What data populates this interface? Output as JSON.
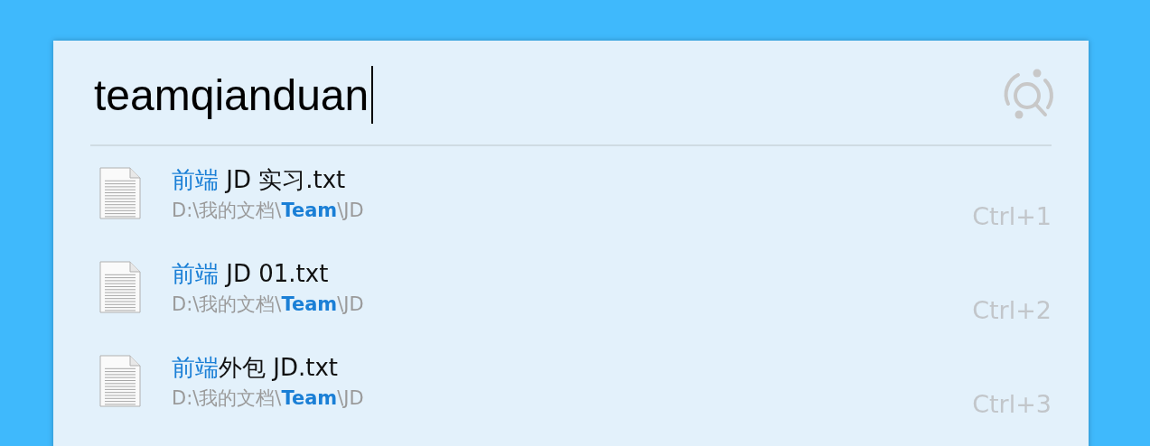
{
  "search": {
    "value": "teamqianduan"
  },
  "results": [
    {
      "title": [
        {
          "text": "前端",
          "match": true
        },
        {
          "text": " JD 实习.txt",
          "match": false
        }
      ],
      "path": [
        {
          "text": "D:\\我的文档\\",
          "match": false
        },
        {
          "text": "Team",
          "match": true
        },
        {
          "text": "\\JD",
          "match": false
        }
      ],
      "shortcut": "Ctrl+1"
    },
    {
      "title": [
        {
          "text": "前端",
          "match": true
        },
        {
          "text": " JD 01.txt",
          "match": false
        }
      ],
      "path": [
        {
          "text": "D:\\我的文档\\",
          "match": false
        },
        {
          "text": "Team",
          "match": true
        },
        {
          "text": "\\JD",
          "match": false
        }
      ],
      "shortcut": "Ctrl+2"
    },
    {
      "title": [
        {
          "text": "前端",
          "match": true
        },
        {
          "text": "外包 JD.txt",
          "match": false
        }
      ],
      "path": [
        {
          "text": "D:\\我的文档\\",
          "match": false
        },
        {
          "text": "Team",
          "match": true
        },
        {
          "text": "\\JD",
          "match": false
        }
      ],
      "shortcut": "Ctrl+3"
    }
  ]
}
